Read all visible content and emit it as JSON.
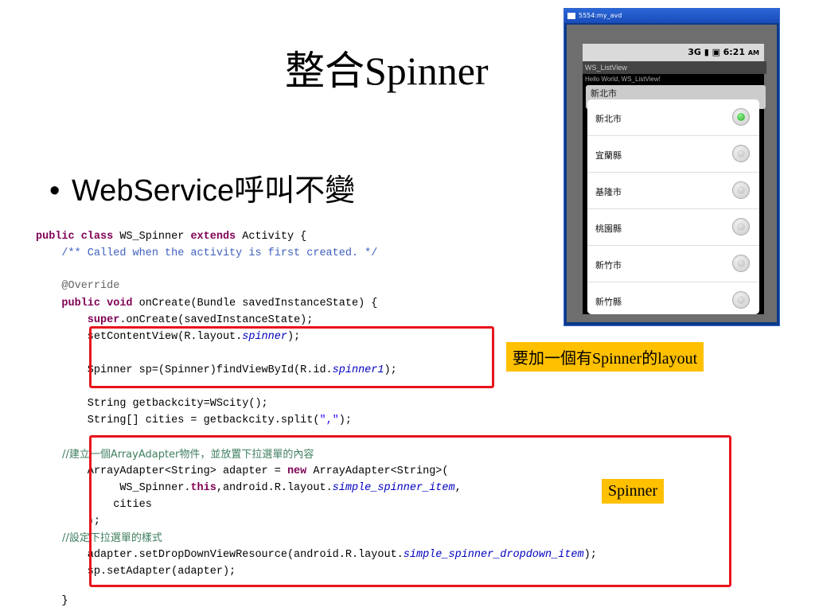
{
  "slide": {
    "title": "整合Spinner",
    "bullet_marker": "•",
    "bullet": "WebService呼叫不變"
  },
  "code": {
    "l1_kw1": "public class",
    "l1_rest": " WS_Spinner ",
    "l1_kw2": "extends",
    "l1_tail": " Activity {",
    "l2": "    /** Called when the activity is first created. */",
    "l3": "    @Override",
    "l4_kw": "    public void",
    "l4_rest": " onCreate(Bundle savedInstanceState) {",
    "l5_kw": "        super",
    "l5_rest": ".onCreate(savedInstanceState);",
    "l6_a": "        setContentView(R.layout.",
    "l6_f": "spinner",
    "l6_b": ");",
    "l7_a": "        Spinner sp=(Spinner)findViewById(R.id.",
    "l7_f": "spinner1",
    "l7_b": ");",
    "l8": "        String getbackcity=WScity();",
    "l9_a": "        String[] cities = getbackcity.split(",
    "l9_s": "\",\"",
    "l9_b": ");",
    "l10": "        //建立一個ArrayAdapter物件，並放置下拉選單的內容",
    "l11_a": "        ArrayAdapter<String> adapter = ",
    "l11_kw": "new",
    "l11_b": " ArrayAdapter<String>(",
    "l12_a": "             WS_Spinner.",
    "l12_kw": "this",
    "l12_b": ",android.R.layout.",
    "l12_f": "simple_spinner_item",
    "l12_c": ",",
    "l13": "            cities",
    "l14": "        );",
    "l15": "        //設定下拉選單的樣式",
    "l16_a": "        adapter.setDropDownViewResource(android.R.layout.",
    "l16_f": "simple_spinner_dropdown_item",
    "l16_b": ");",
    "l17": "        sp.setAdapter(adapter);",
    "l18": "    }"
  },
  "callouts": {
    "layout_note": "要加一個有Spinner的layout",
    "spinner_note": "Spinner"
  },
  "emulator": {
    "window_title": "5554:my_avd",
    "status_icons": "3G ▮ ▣",
    "clock": "6:21",
    "clock_ampm": "AM",
    "app_title": "WS_ListView",
    "hello_text": "Hello World, WS_ListView!",
    "spinner_current": "新北市",
    "options": [
      {
        "label": "新北市",
        "checked": true
      },
      {
        "label": "宜蘭縣",
        "checked": false
      },
      {
        "label": "基隆市",
        "checked": false
      },
      {
        "label": "桃園縣",
        "checked": false
      },
      {
        "label": "新竹市",
        "checked": false
      },
      {
        "label": "新竹縣",
        "checked": false
      }
    ]
  },
  "colors": {
    "highlight_box": "#e8141c",
    "callout_bg": "#ffc000",
    "keyword": "#7f0055",
    "javadoc": "#3f5fbf",
    "field": "#0000c0"
  }
}
